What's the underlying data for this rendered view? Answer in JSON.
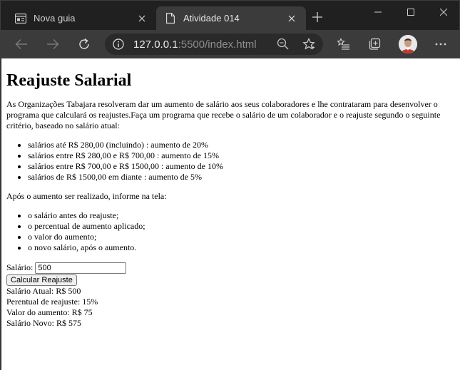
{
  "browser": {
    "tabs": [
      {
        "label": "Nova guia",
        "active": false
      },
      {
        "label": "Atividade 014",
        "active": true
      }
    ],
    "url": {
      "host": "127.0.0.1",
      "rest": ":5500/index.html"
    }
  },
  "page": {
    "title": "Reajuste Salarial",
    "intro": "As Organizações Tabajara resolveram dar um aumento de salário aos seus colaboradores e lhe contrataram para desenvolver o programa que calculará os reajustes.Faça um programa que recebe o salário de um colaborador e o reajuste segundo o seguinte critério, baseado no salário atual:",
    "criteria": [
      "salários até R$ 280,00 (incluindo) : aumento de 20%",
      "salários entre R$ 280,00 e R$ 700,00 : aumento de 15%",
      "salários entre R$ 700,00 e R$ 1500,00 : aumento de 10%",
      "salários de R$ 1500,00 em diante : aumento de 5%"
    ],
    "after_label": "Após o aumento ser realizado, informe na tela:",
    "outputs": [
      "o salário antes do reajuste;",
      "o percentual de aumento aplicado;",
      "o valor do aumento;",
      "o novo salário, após o aumento."
    ],
    "form": {
      "salary_label": "Salário:",
      "salary_value": "500",
      "button_label": "Calcular Reajuste"
    },
    "result": [
      "Salário Atual: R$ 500",
      "Perentual de reajuste: 15%",
      "Valor do aumento: R$ 75",
      "Salário Novo: R$ 575"
    ]
  }
}
